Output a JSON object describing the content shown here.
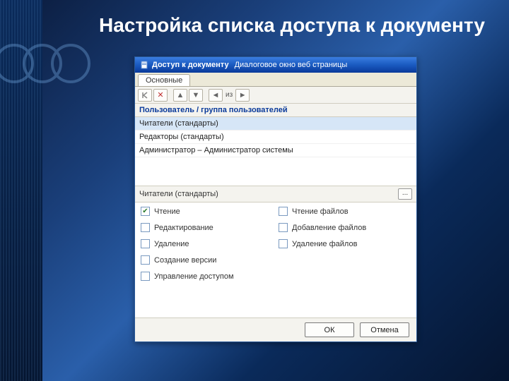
{
  "slide": {
    "title": "Настройка списка доступа к документу"
  },
  "dialog": {
    "title": "Доступ к документу",
    "subtitle": "Диалоговое окно веб страницы",
    "tab": "Основные",
    "column_header": "Пользователь / группа пользователей",
    "users": [
      "Читатели (стандарты)",
      "Редакторы (стандарты)",
      "Администратор – Администратор системы"
    ],
    "selected_user": "Читатели (стандарты)",
    "ellipsis": "...",
    "permissions": {
      "left": [
        {
          "label": "Чтение",
          "checked": true
        },
        {
          "label": "Редактирование",
          "checked": false
        },
        {
          "label": "Удаление",
          "checked": false
        },
        {
          "label": "Создание версии",
          "checked": false
        },
        {
          "label": "Управление доступом",
          "checked": false
        }
      ],
      "right": [
        {
          "label": "Чтение файлов",
          "checked": false
        },
        {
          "label": "Добавление файлов",
          "checked": false
        },
        {
          "label": "Удаление файлов",
          "checked": false
        }
      ]
    },
    "buttons": {
      "ok": "ОК",
      "cancel": "Отмена"
    }
  },
  "toolbar_text": "из"
}
